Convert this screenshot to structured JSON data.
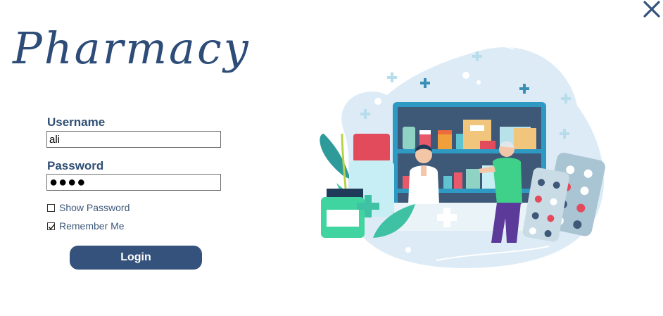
{
  "app": {
    "title": "Pharmacy"
  },
  "form": {
    "username_label": "Username",
    "username_value": "ali",
    "password_label": "Password",
    "password_value": "●●●●",
    "show_password": {
      "label": "Show Password",
      "checked": false
    },
    "remember_me": {
      "label": "Remember Me",
      "checked": true
    },
    "login_label": "Login"
  },
  "icons": {
    "close": "close-icon",
    "illustration": "pharmacy-illustration"
  },
  "colors": {
    "accent": "#34527c",
    "brand": "#2d4c77",
    "illustration_bg": "#dcebf5",
    "teal": "#3fc1a4"
  }
}
